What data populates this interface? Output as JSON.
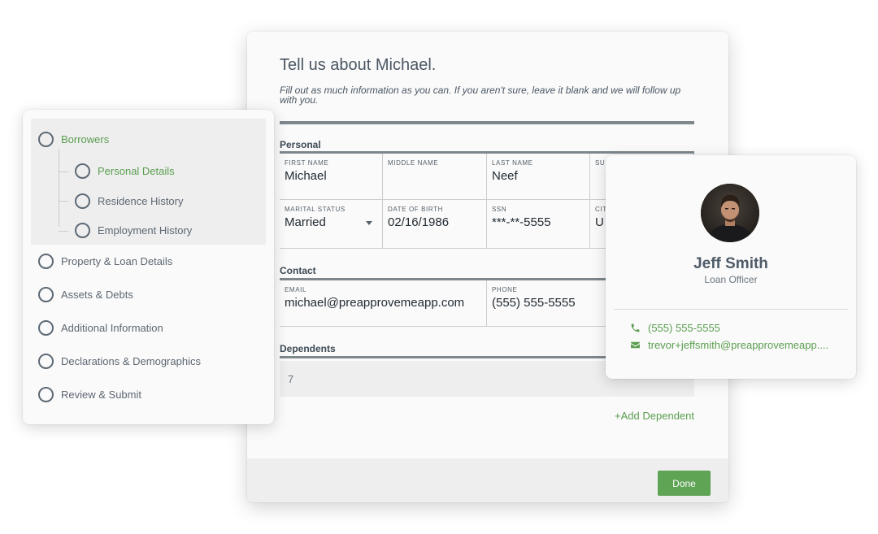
{
  "form": {
    "title": "Tell us about Michael.",
    "subtitle": "Fill out as much information as you can. If you aren't sure, leave it blank and we will follow up with you.",
    "sections": {
      "personal": "Personal",
      "contact": "Contact",
      "dependents": "Dependents"
    },
    "fields": {
      "first_name": {
        "label": "First Name",
        "value": "Michael"
      },
      "middle_name": {
        "label": "Middle Name",
        "value": ""
      },
      "last_name": {
        "label": "Last Name",
        "value": "Neef"
      },
      "suffix": {
        "label": "Suffix",
        "value": ""
      },
      "marital_status": {
        "label": "Marital Status",
        "value": "Married"
      },
      "date_of_birth": {
        "label": "Date of Birth",
        "value": "02/16/1986"
      },
      "ssn": {
        "label": "SSN",
        "value": "***-**-5555"
      },
      "citizenship": {
        "label": "Citizenship",
        "value": "U"
      },
      "email": {
        "label": "Email",
        "value": "michael@preapprovemeapp.com"
      },
      "phone": {
        "label": "Phone",
        "value": "(555) 555-5555"
      }
    },
    "dependents_count": "7",
    "add_dependent_label": "+Add Dependent",
    "done_label": "Done"
  },
  "nav": {
    "items": [
      {
        "label": "Borrowers",
        "active": true
      },
      {
        "label": "Personal Details",
        "active": true
      },
      {
        "label": "Residence History",
        "active": false
      },
      {
        "label": "Employment History",
        "active": false
      },
      {
        "label": "Property & Loan Details",
        "active": false
      },
      {
        "label": "Assets & Debts",
        "active": false
      },
      {
        "label": "Additional Information",
        "active": false
      },
      {
        "label": "Declarations & Demographics",
        "active": false
      },
      {
        "label": "Review & Submit",
        "active": false
      }
    ]
  },
  "officer": {
    "name": "Jeff Smith",
    "role": "Loan Officer",
    "phone": "(555) 555-5555",
    "email": "trevor+jeffsmith@preapprovemeapp...."
  },
  "colors": {
    "accent_green": "#5a9e4f",
    "button_green": "#5fa355",
    "rule_gray": "#7d878c",
    "text_dark": "#3d4a55"
  },
  "icons": {
    "phone": "phone-icon",
    "email": "envelope-icon",
    "dropdown": "chevron-down-icon"
  }
}
